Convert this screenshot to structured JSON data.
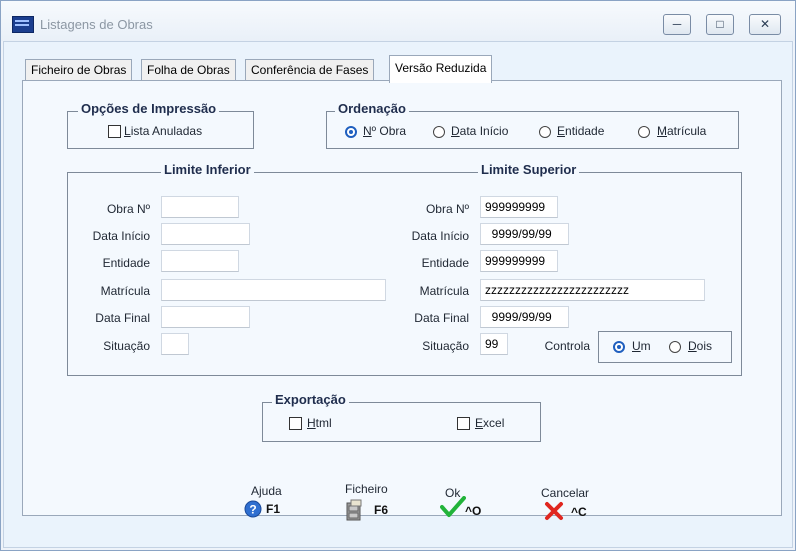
{
  "window": {
    "title": "Listagens de Obras",
    "minimize": "─",
    "maximize": "□",
    "close": "✕"
  },
  "tabs": [
    "Ficheiro de Obras",
    "Folha de Obras",
    "Conferência de Fases",
    "Versão Reduzida"
  ],
  "active_tab": "Versão Reduzida",
  "opcoes_impressao": {
    "title": "Opções de Impressão",
    "lista_anuladas": {
      "prefix": "L",
      "rest": "ista Anuladas",
      "checked": false
    }
  },
  "ordenacao": {
    "title": "Ordenação",
    "options": [
      {
        "prefix": "N",
        "rest": "º Obra",
        "selected": true
      },
      {
        "prefix": "D",
        "rest": "ata Início",
        "selected": false
      },
      {
        "prefix": "E",
        "rest": "ntidade",
        "selected": false
      },
      {
        "prefix": "M",
        "rest": "atrícula",
        "selected": false
      }
    ]
  },
  "limite_inferior": {
    "title": "Limite Inferior",
    "labels": {
      "obra": "Obra Nº",
      "data_inicio": "Data Início",
      "entidade": "Entidade",
      "matricula": "Matrícula",
      "data_final": "Data Final",
      "situacao": "Situação"
    },
    "values": {
      "obra": "",
      "data_inicio": "",
      "entidade": "",
      "matricula": "",
      "data_final": "",
      "situacao": ""
    }
  },
  "limite_superior": {
    "title": "Limite Superior",
    "labels": {
      "obra": "Obra Nº",
      "data_inicio": "Data Início",
      "entidade": "Entidade",
      "matricula": "Matrícula",
      "data_final": "Data Final",
      "situacao": "Situação"
    },
    "values": {
      "obra": "999999999",
      "data_inicio": "  9999/99/99",
      "entidade": "999999999",
      "matricula": "zzzzzzzzzzzzzzzzzzzzzzzz",
      "data_final": "  9999/99/99",
      "situacao": "99"
    }
  },
  "controla": {
    "label": "Controla",
    "um": {
      "prefix": "U",
      "rest": "m",
      "selected": true
    },
    "dois": {
      "prefix": "D",
      "rest": "ois",
      "selected": false
    }
  },
  "exportacao": {
    "title": "Exportação",
    "html": {
      "prefix": "H",
      "rest": "tml",
      "checked": false
    },
    "excel": {
      "prefix": "E",
      "rest": "xcel",
      "checked": false
    }
  },
  "buttons": {
    "ajuda": {
      "label": "Ajuda",
      "key": "F1"
    },
    "ficheiro": {
      "label": "Ficheiro",
      "key": "F6"
    },
    "ok": {
      "label": "Ok",
      "key": "^O"
    },
    "cancelar": {
      "label": "Cancelar",
      "key": "^C"
    }
  },
  "colors": {
    "accent": "#1f5fbf",
    "ok_green": "#22b33a",
    "cancel_red": "#e0261f",
    "group_title": "#1f2d4d"
  }
}
